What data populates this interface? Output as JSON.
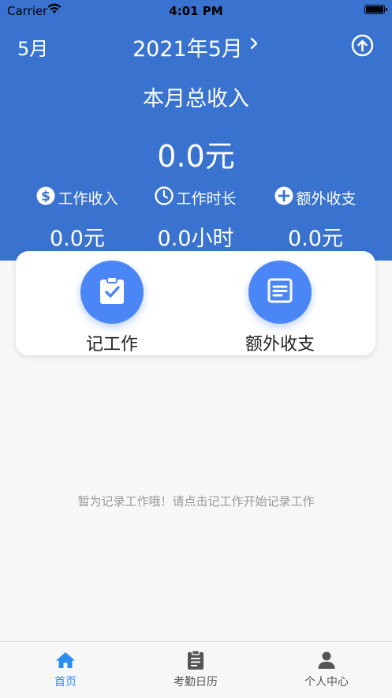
{
  "status_bar": {
    "carrier": "Carrier",
    "time": "4:01 PM"
  },
  "header": {
    "month_short": "5月",
    "month_title": "2021年5月",
    "total_label": "本月总收入",
    "total_value": "0.0元",
    "stats": [
      {
        "icon": "dollar-icon",
        "label": "工作收入",
        "value": "0.0元"
      },
      {
        "icon": "clock-icon",
        "label": "工作时长",
        "value": "0.0小时"
      },
      {
        "icon": "plus-circle-icon",
        "label": "额外收支",
        "value": "0.0元"
      }
    ]
  },
  "actions": {
    "record_work_label": "记工作",
    "extra_income_label": "额外收支"
  },
  "empty_message": "暂为记录工作哦！请点击记工作开始记录工作",
  "tabbar": {
    "items": [
      {
        "icon": "home-icon",
        "label": "首页"
      },
      {
        "icon": "clipboard-icon",
        "label": "考勤日历"
      },
      {
        "icon": "person-icon",
        "label": "个人中心"
      }
    ]
  },
  "colors": {
    "header": "#3973cf",
    "accent": "#4a86f5",
    "tab_active": "#2d8cf0"
  }
}
